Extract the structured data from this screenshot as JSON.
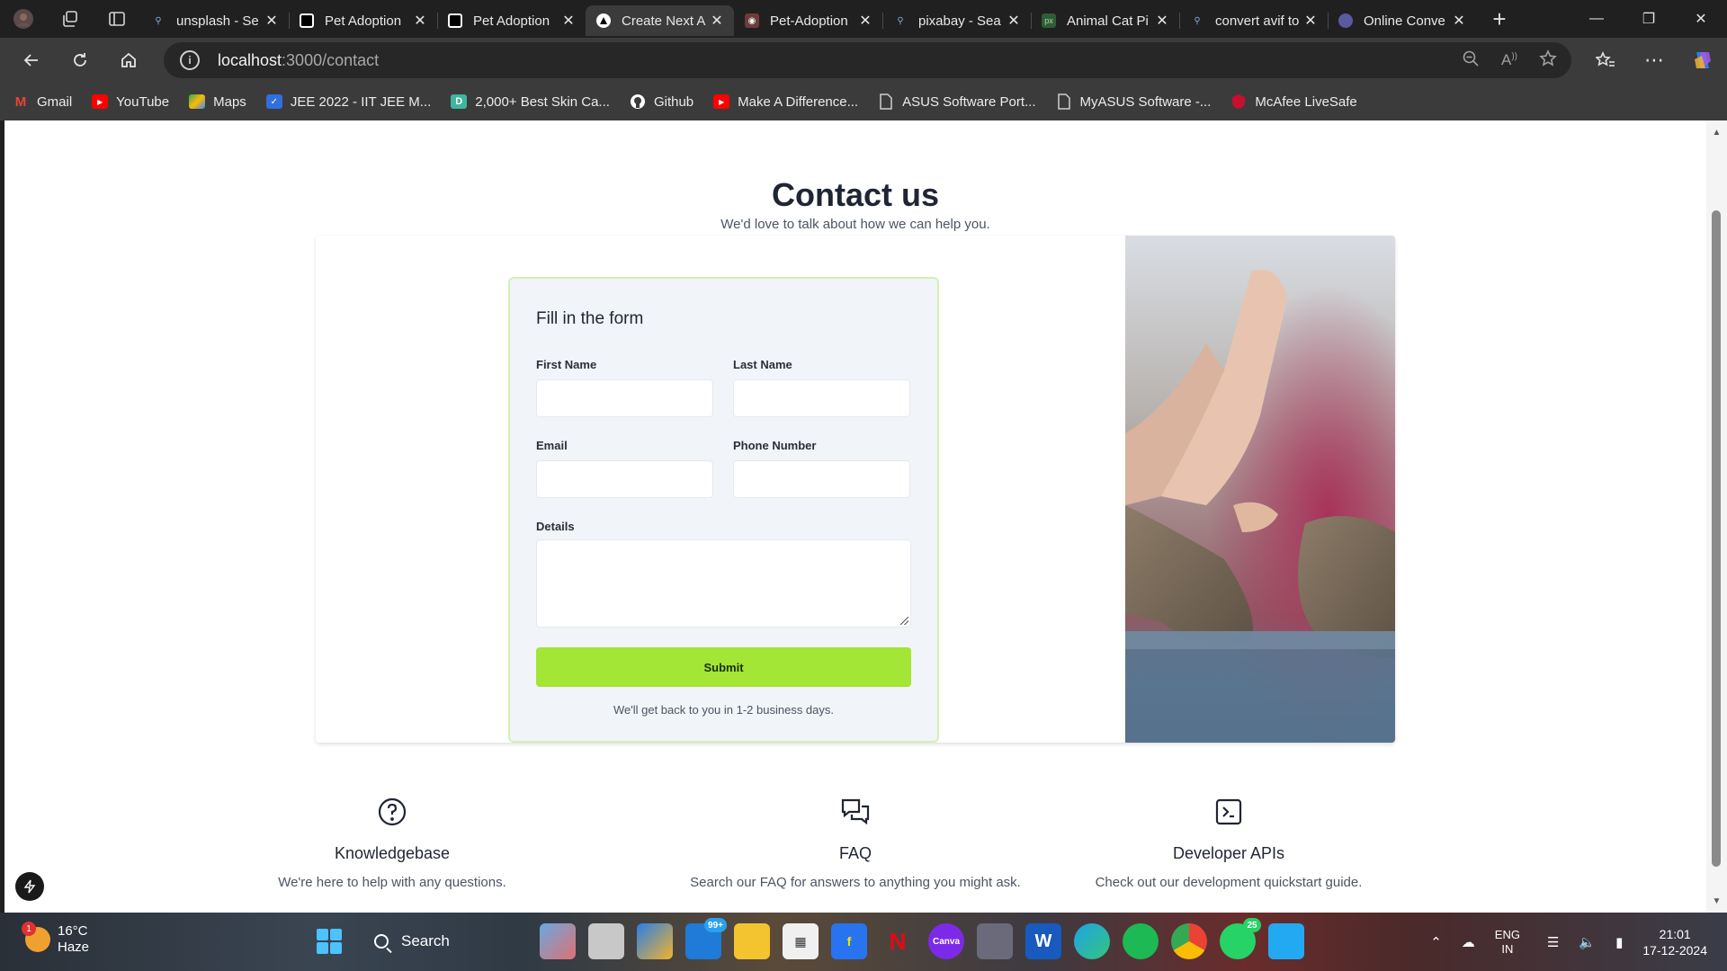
{
  "browser": {
    "tabs": [
      {
        "label": "unsplash - Se",
        "favicon": "search-favicon",
        "active": false
      },
      {
        "label": "Pet Adoption",
        "favicon": "pet-adoption-favicon",
        "active": false
      },
      {
        "label": "Pet Adoption",
        "favicon": "pet-adoption-favicon",
        "active": false
      },
      {
        "label": "Create Next A",
        "favicon": "vercel-favicon",
        "active": true
      },
      {
        "label": "Pet-Adoption",
        "favicon": "github-favicon",
        "active": false
      },
      {
        "label": "pixabay - Sea",
        "favicon": "search-favicon",
        "active": false
      },
      {
        "label": "Animal Cat Pi",
        "favicon": "pixabay-favicon",
        "active": false
      },
      {
        "label": "convert avif to",
        "favicon": "search-favicon",
        "active": false
      },
      {
        "label": "Online Conve",
        "favicon": "converter-favicon",
        "active": false
      }
    ],
    "url_host": "localhost",
    "url_path": ":3000/contact",
    "bookmarks": [
      {
        "label": "Gmail",
        "icon": "gmail-icon",
        "color": "#ea4335"
      },
      {
        "label": "YouTube",
        "icon": "youtube-icon",
        "color": "#ff0000"
      },
      {
        "label": "Maps",
        "icon": "maps-icon",
        "color": "#34a853"
      },
      {
        "label": "JEE 2022 - IIT JEE M...",
        "icon": "jee-icon",
        "color": "#2f6fe0"
      },
      {
        "label": "2,000+ Best Skin Ca...",
        "icon": "skincare-icon",
        "color": "#3fb5a0"
      },
      {
        "label": "Github",
        "icon": "github-icon",
        "color": "#ffffff"
      },
      {
        "label": "Make A Difference...",
        "icon": "youtube-icon",
        "color": "#ff0000"
      },
      {
        "label": "ASUS Software Port...",
        "icon": "document-icon",
        "color": "#cfcfcf"
      },
      {
        "label": "MyASUS Software -...",
        "icon": "document-icon",
        "color": "#cfcfcf"
      },
      {
        "label": "McAfee LiveSafe",
        "icon": "mcafee-icon",
        "color": "#c8102e"
      }
    ]
  },
  "page": {
    "title": "Contact us",
    "subtitle": "We'd love to talk about how we can help you.",
    "form": {
      "title": "Fill in the form",
      "first_name_label": "First Name",
      "last_name_label": "Last Name",
      "email_label": "Email",
      "phone_label": "Phone Number",
      "details_label": "Details",
      "first_name_value": "",
      "last_name_value": "",
      "email_value": "",
      "phone_value": "",
      "details_value": "",
      "submit_label": "Submit",
      "note": "We'll get back to you in 1-2 business days."
    },
    "features": [
      {
        "icon": "question-circle-icon",
        "title": "Knowledgebase",
        "desc": "We're here to help with any questions."
      },
      {
        "icon": "chat-bubbles-icon",
        "title": "FAQ",
        "desc": "Search our FAQ for answers to anything you might ask."
      },
      {
        "icon": "terminal-icon",
        "title": "Developer APIs",
        "desc": "Check out our development quickstart guide."
      }
    ],
    "accent_color": "#a3e635"
  },
  "taskbar": {
    "weather_temp": "16°C",
    "weather_cond": "Haze",
    "weather_badge": "1",
    "search_label": "Search",
    "mail_badge": "99+",
    "whatsapp_badge": "25",
    "lang_top": "ENG",
    "lang_bottom": "IN",
    "time": "21:01",
    "date": "17-12-2024"
  }
}
